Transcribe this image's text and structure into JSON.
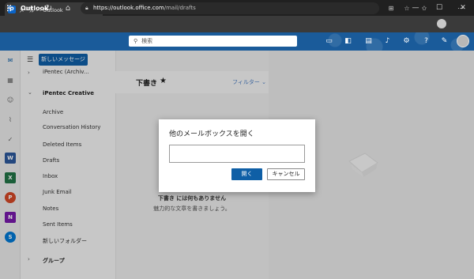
{
  "browser": {
    "tab_title": "メール -      - Outlook",
    "favicon": "O",
    "new_tab": "+",
    "url_domain": "https://outlook.office.com",
    "url_path": "/mail/drafts"
  },
  "header": {
    "brand": "Outlook",
    "search_placeholder": "検索",
    "accent": "#1a5b9a"
  },
  "toolbar": {
    "new_message_label": "新しいメッセージ"
  },
  "folders": {
    "top_item": "iPentec    (Archiv...",
    "group_name": "iPentec Creative",
    "items": [
      "Archive",
      "Conversation History",
      "Deleted Items",
      "Drafts",
      "Inbox",
      "Junk Email",
      "Notes",
      "Sent Items",
      "新しいフォルダー"
    ],
    "groups_label": "グループ"
  },
  "message_list": {
    "title": "下書き",
    "star": "★",
    "filter_label": "フィルター",
    "empty_title": "下書き には何もありません",
    "empty_subtitle": "魅力的な文章を書きましょう。"
  },
  "dialog": {
    "title": "他のメールボックスを開く",
    "input_value": "",
    "open_label": "開く",
    "cancel_label": "キャンセル"
  },
  "rail_apps": [
    "Word",
    "Excel",
    "PowerPoint",
    "OneNote",
    "Skype"
  ],
  "colors": {
    "primary_button": "#0f5fa6",
    "link": "#4a7cc1"
  }
}
